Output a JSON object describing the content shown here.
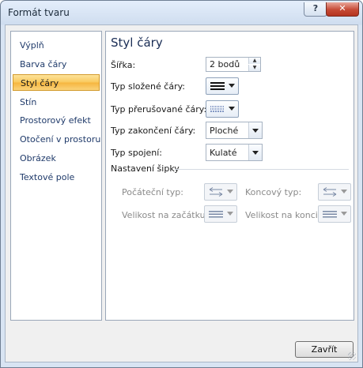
{
  "window": {
    "title": "Formát tvaru",
    "help_label": "?",
    "close_label": "✕"
  },
  "sidebar": {
    "items": [
      {
        "label": "Výplň"
      },
      {
        "label": "Barva čáry"
      },
      {
        "label": "Styl čáry",
        "selected": true
      },
      {
        "label": "Stín"
      },
      {
        "label": "Prostorový efekt"
      },
      {
        "label": "Otočení v prostoru"
      },
      {
        "label": "Obrázek"
      },
      {
        "label": "Textové pole"
      }
    ]
  },
  "panel": {
    "title": "Styl čáry",
    "width": {
      "label": "Šířka:",
      "value": "2 bodů"
    },
    "compound": {
      "label": "Typ složené čáry:",
      "icon": "compound-lines-icon"
    },
    "dash": {
      "label": "Typ přerušované čáry:",
      "icon": "dash-lines-icon"
    },
    "cap": {
      "label": "Typ zakončení čáry:",
      "value": "Ploché"
    },
    "join": {
      "label": "Typ spojení:",
      "value": "Kulaté"
    },
    "arrows": {
      "section_label": "Nastavení šipky",
      "begin_type": {
        "label": "Počáteční typ:",
        "icon": "arrow-type-icon"
      },
      "end_type": {
        "label": "Koncový typ:",
        "icon": "arrow-type-icon"
      },
      "begin_size": {
        "label": "Velikost na začátku:",
        "icon": "arrow-size-icon"
      },
      "end_size": {
        "label": "Velikost na konci:",
        "icon": "arrow-size-icon"
      }
    }
  },
  "footer": {
    "close_button": "Zavřít"
  },
  "colors": {
    "selected_item": "#f9c85c",
    "nav_text": "#1f3a6a",
    "disabled_text": "#8a8a8a"
  }
}
